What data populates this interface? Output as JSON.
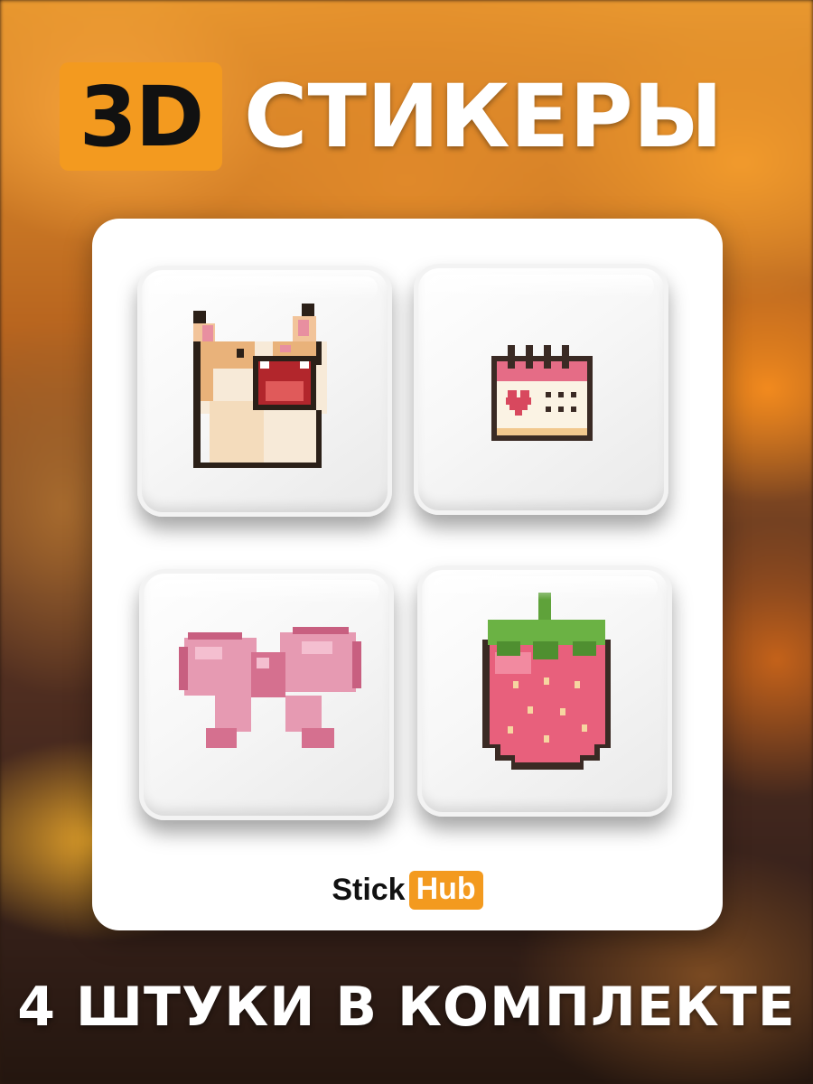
{
  "title": {
    "badge": "3D",
    "word": "СТИКЕРЫ"
  },
  "stickers": [
    {
      "icon": "screaming-cat-icon"
    },
    {
      "icon": "calendar-heart-icon"
    },
    {
      "icon": "pink-bow-icon"
    },
    {
      "icon": "strawberry-icon"
    }
  ],
  "logo": {
    "part1": "Stick",
    "part2": "Hub"
  },
  "subtitle": "4 ШТУКИ В КОМПЛЕКТЕ",
  "colors": {
    "accent": "#f39a1f",
    "card": "#ffffff",
    "text_light": "#ffffff",
    "text_dark": "#111111"
  }
}
